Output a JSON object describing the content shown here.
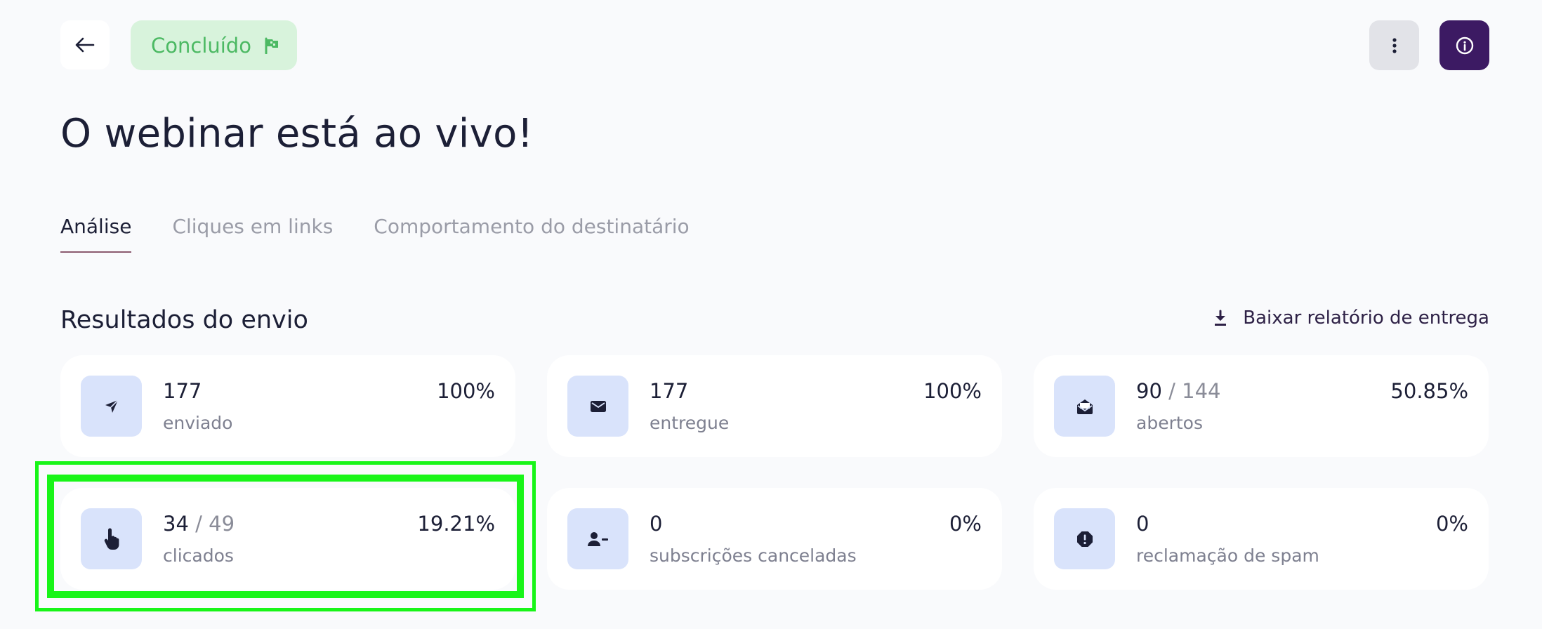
{
  "header": {
    "status_label": "Concluído",
    "icons": {
      "back": "arrow-left-icon",
      "status": "flag-icon",
      "more": "vertical-dots-icon",
      "info": "info-icon"
    }
  },
  "page_title": "O webinar está ao vivo!",
  "tabs": [
    {
      "label": "Análise",
      "active": true
    },
    {
      "label": "Cliques em links",
      "active": false
    },
    {
      "label": "Comportamento do destinatário",
      "active": false
    }
  ],
  "section": {
    "title": "Resultados do envio",
    "download_label": "Baixar relatório de entrega"
  },
  "cards": [
    {
      "value": "177",
      "total": "",
      "label": "enviado",
      "pct": "100%",
      "icon": "send-icon"
    },
    {
      "value": "177",
      "total": "",
      "label": "entregue",
      "pct": "100%",
      "icon": "envelope-icon"
    },
    {
      "value": "90",
      "total": "/ 144",
      "label": "abertos",
      "pct": "50.85%",
      "icon": "envelope-open-icon"
    },
    {
      "value": "34",
      "total": "/ 49",
      "label": "clicados",
      "pct": "19.21%",
      "icon": "pointer-hand-icon",
      "highlighted": true
    },
    {
      "value": "0",
      "total": "",
      "label": "subscrições canceladas",
      "pct": "0%",
      "icon": "user-minus-icon"
    },
    {
      "value": "0",
      "total": "",
      "label": "reclamação de spam",
      "pct": "0%",
      "icon": "spam-alert-icon"
    }
  ],
  "colors": {
    "accent": "#3c1a63",
    "status_bg": "#d8f3dc",
    "status_text": "#4cb963",
    "icon_box": "#d9e3fb",
    "highlight": "#18f518"
  }
}
